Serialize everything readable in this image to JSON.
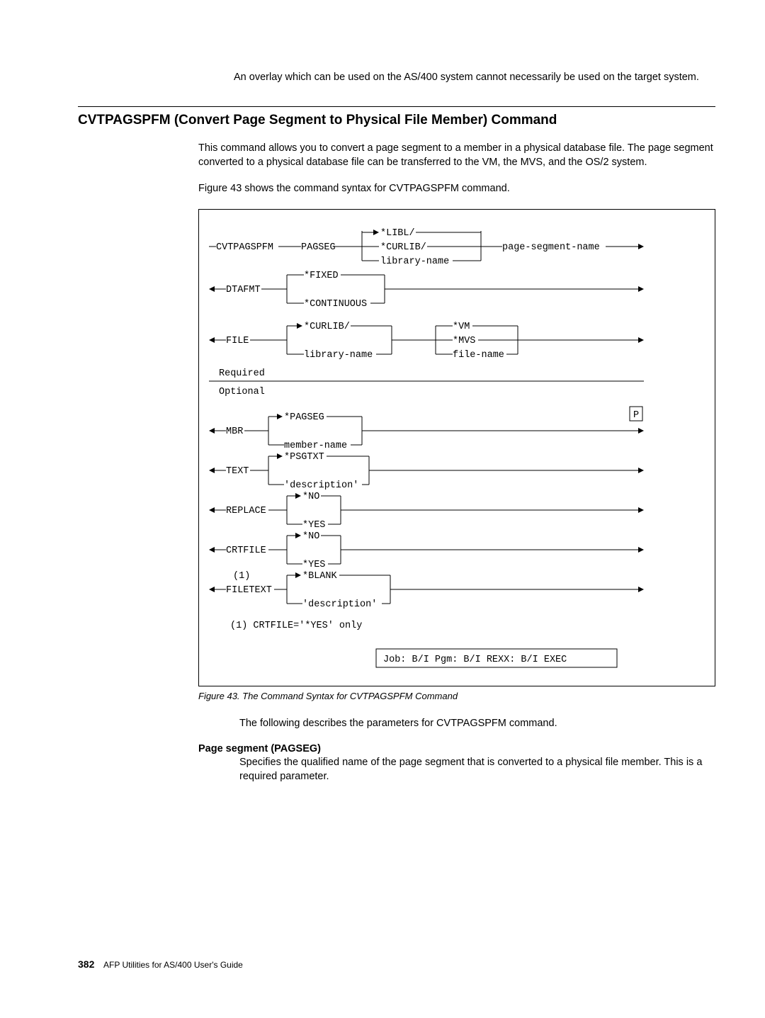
{
  "intro": "An overlay which can be used on the AS/400 system cannot necessarily be used on the target system.",
  "section_heading": "CVTPAGSPFM (Convert Page Segment to Physical File Member) Command",
  "para1": "This command allows you to convert a page segment to a member in a physical database file.  The page segment converted to a physical database file can be transferred to the VM, the MVS, and the OS/2 system.",
  "para2": "Figure 43 shows the command syntax for CVTPAGSPFM command.",
  "figure_caption": "Figure 43. The Command Syntax for CVTPAGSPFM Command",
  "para3": "The following describes the parameters for CVTPAGSPFM command.",
  "param1_title": "Page segment (PAGSEG)",
  "param1_body": "Specifies the qualified name of the page segment that is converted to a physical file member.  This is a required parameter.",
  "footer_page": "382",
  "footer_text": "AFP Utilities for AS/400 User's Guide",
  "syntax": {
    "cmd": "CVTPAGSPFM",
    "pagseg_kw": "PAGSEG",
    "libl": "*LIBL/",
    "curlib": "*CURLIB/",
    "libname": "library-name",
    "pagseg_name": "page-segment-name",
    "dtafmt": "DTAFMT",
    "fixed": "*FIXED",
    "continuous": "*CONTINUOUS",
    "file": "FILE",
    "vm": "*VM",
    "mvs": "*MVS",
    "filename": "file-name",
    "required": "Required",
    "optional": "Optional",
    "mbr": "MBR",
    "pagseg_opt": "*PAGSEG",
    "membername": "member-name",
    "text": "TEXT",
    "psgtxt": "*PSGTXT",
    "description": "'description'",
    "replace": "REPLACE",
    "no": "*NO",
    "yes": "*YES",
    "crtfile": "CRTFILE",
    "filetext": "FILETEXT",
    "blank": "*BLANK",
    "note1_ref": "(1)",
    "note1": "(1) CRTFILE='*YES' only",
    "p_badge": "P",
    "job_box": "Job: B/I  Pgm: B/I REXX: B/I  EXEC"
  }
}
